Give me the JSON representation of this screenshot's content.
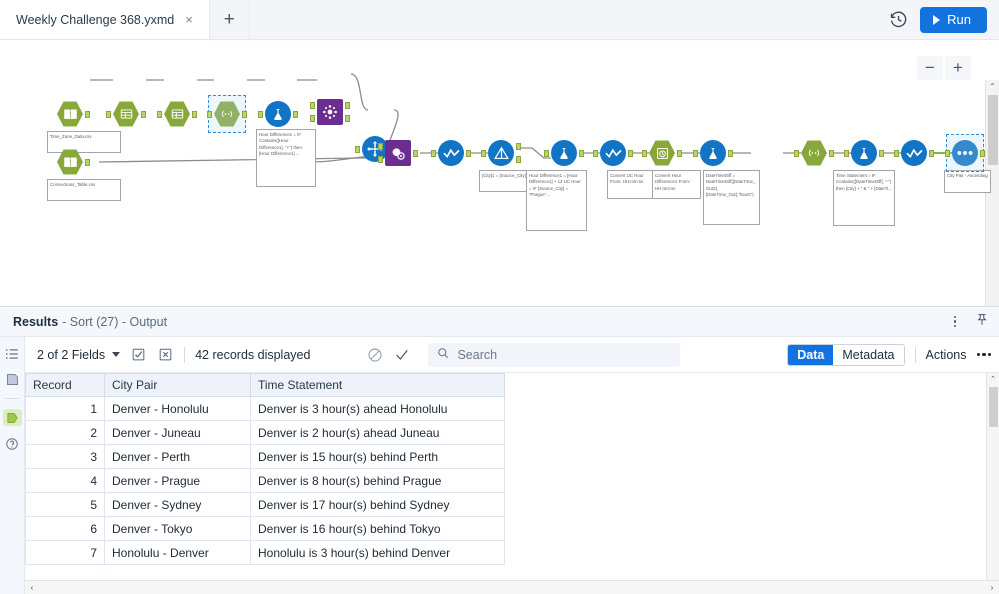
{
  "tabbar": {
    "tab_title": "Weekly Challenge 368.yxmd",
    "close_label": "×",
    "add_label": "+",
    "history_icon": "history-clock-icon",
    "run_label": "Run"
  },
  "canvas": {
    "zoom_out": "−",
    "zoom_in": "+",
    "scroll_left": "‹",
    "scroll_right": "›",
    "scroll_up": "⌃",
    "scroll_down": "⌄",
    "nodes": [
      {
        "id": "input1",
        "label": "Time_Zone_Data.csv",
        "shape": "hex",
        "icon": "input-data-icon"
      },
      {
        "id": "select1",
        "label": "",
        "shape": "hex",
        "icon": "select-icon"
      },
      {
        "id": "select2",
        "label": "",
        "shape": "hex",
        "icon": "select-icon"
      },
      {
        "id": "regex1",
        "label": "",
        "shape": "hex",
        "icon": "regex-icon"
      },
      {
        "id": "formula1",
        "label": "Hour Difference1 = IF Contains([Hour Difference1], \"+\") then [Hour Difference1] ...",
        "shape": "circ",
        "icon": "formula-icon"
      },
      {
        "id": "appendfields",
        "label": "",
        "shape": "sq",
        "icon": "append-fields-icon"
      },
      {
        "id": "transpose",
        "label": "",
        "shape": "circ",
        "icon": "transpose-icon"
      },
      {
        "id": "join",
        "label": "",
        "shape": "sq",
        "icon": "join-icon"
      },
      {
        "id": "input2",
        "label": "Connections_Table.csv",
        "shape": "hex",
        "icon": "input-data-icon"
      },
      {
        "id": "select3",
        "label": "",
        "shape": "circ",
        "icon": "select-records-icon"
      },
      {
        "id": "filter1",
        "label": "[City]1 = [Source_City]",
        "shape": "circ",
        "icon": "filter-icon"
      },
      {
        "id": "formula2",
        "label": "Hour Difference1 = [Hour Difference1] + 12  UC Hour = IF [Source_City] = \"Prague\"...",
        "shape": "circ",
        "icon": "formula-icon"
      },
      {
        "id": "select4",
        "label": "",
        "shape": "circ",
        "icon": "select-records-icon"
      },
      {
        "id": "datetime1",
        "label": "Convert UC Hour From: HH:mm:ss",
        "shape": "hex",
        "icon": "datetime-icon"
      },
      {
        "id": "datetime2",
        "label": "Convert Hour Difference1 From: HH:mm:ss",
        "shape": "hex",
        "icon": "datetime-icon"
      },
      {
        "id": "formula3",
        "label": "DateTimeDiff = DateTimeDiff([DateTime_Out2], [DateTime_Out],\"hours\")",
        "shape": "circ",
        "icon": "formula-icon"
      },
      {
        "id": "regex2",
        "label": "",
        "shape": "hex",
        "icon": "regex-icon"
      },
      {
        "id": "formula4",
        "label": "Time Statement = IF Contains([DateTimeDiff], \"-\") then [City] + \" & \" + [DateTi...",
        "shape": "circ",
        "icon": "formula-icon"
      },
      {
        "id": "select5",
        "label": "",
        "shape": "circ",
        "icon": "select-records-icon"
      },
      {
        "id": "sort1",
        "label": "City Pair - Ascending",
        "shape": "circ",
        "icon": "sort-icon"
      }
    ]
  },
  "results": {
    "title": "Results",
    "subtitle": "- Sort (27) - Output",
    "kebab_icon": "more-vertical-icon",
    "pin_icon": "pin-icon",
    "rail": [
      {
        "name": "list-view-icon",
        "active": false
      },
      {
        "name": "data-box-icon",
        "active": false
      },
      {
        "name": "output-anchor-icon",
        "active": true
      },
      {
        "name": "help-icon",
        "active": false
      }
    ],
    "toolbar": {
      "fields_label": "2 of 2 Fields",
      "select_all_icon": "checkbox-checked-icon",
      "deselect_all_icon": "checkbox-clear-icon",
      "records_label": "42 records displayed",
      "cancel_icon": "no-entry-icon",
      "accept_icon": "checkmark-icon",
      "search_icon": "search-icon",
      "search_value": "",
      "search_placeholder": "Search",
      "tab_data": "Data",
      "tab_metadata": "Metadata",
      "actions_label": "Actions",
      "actions_dots": "more-horizontal-icon"
    },
    "columns": [
      "Record",
      "City Pair",
      "Time Statement"
    ],
    "rows": [
      {
        "record": "1",
        "pair": "Denver - Honolulu",
        "stmt": "Denver is 3 hour(s) ahead Honolulu"
      },
      {
        "record": "2",
        "pair": "Denver - Juneau",
        "stmt": "Denver is 2 hour(s) ahead Juneau"
      },
      {
        "record": "3",
        "pair": "Denver - Perth",
        "stmt": "Denver is 15 hour(s) behind Perth"
      },
      {
        "record": "4",
        "pair": "Denver - Prague",
        "stmt": "Denver is 8 hour(s) behind Prague"
      },
      {
        "record": "5",
        "pair": "Denver - Sydney",
        "stmt": "Denver is 17 hour(s) behind Sydney"
      },
      {
        "record": "6",
        "pair": "Denver - Tokyo",
        "stmt": "Denver is 16 hour(s) behind Tokyo"
      },
      {
        "record": "7",
        "pair": "Honolulu - Denver",
        "stmt": "Honolulu is 3 hour(s) behind Denver"
      }
    ]
  },
  "colors": {
    "accent_blue": "#1273de",
    "tool_green": "#89a83b",
    "tool_blue": "#1274c4",
    "tool_purple": "#6b2d8f",
    "pin_green": "#b8d46a"
  }
}
